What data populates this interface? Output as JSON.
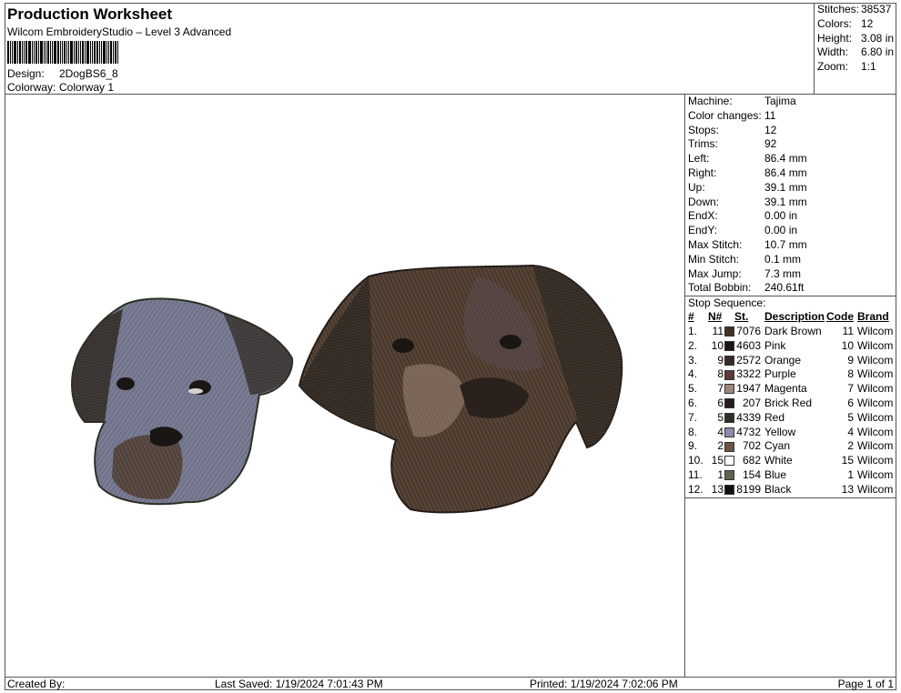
{
  "header": {
    "title": "Production Worksheet",
    "subtitle": "Wilcom EmbroideryStudio – Level 3 Advanced",
    "design_label": "Design:",
    "design_value": "2DogBS6_8",
    "colorway_label": "Colorway:",
    "colorway_value": "Colorway 1"
  },
  "stats": {
    "stitches_label": "Stitches:",
    "stitches_value": "38537",
    "colors_label": "Colors:",
    "colors_value": "12",
    "height_label": "Height:",
    "height_value": "3.08 in",
    "width_label": "Width:",
    "width_value": "6.80 in",
    "zoom_label": "Zoom:",
    "zoom_value": "1:1"
  },
  "machine": [
    {
      "label": "Machine:",
      "value": "Tajima"
    },
    {
      "label": "Color changes:",
      "value": "11"
    },
    {
      "label": "Stops:",
      "value": "12"
    },
    {
      "label": "Trims:",
      "value": "92"
    },
    {
      "label": "Left:",
      "value": "86.4 mm"
    },
    {
      "label": "Right:",
      "value": "86.4 mm"
    },
    {
      "label": "Up:",
      "value": "39.1 mm"
    },
    {
      "label": "Down:",
      "value": "39.1 mm"
    },
    {
      "label": "EndX:",
      "value": "0.00 in"
    },
    {
      "label": "EndY:",
      "value": "0.00 in"
    },
    {
      "label": "Max Stitch:",
      "value": "10.7 mm"
    },
    {
      "label": "Min Stitch:",
      "value": "0.1 mm"
    },
    {
      "label": "Max Jump:",
      "value": "7.3 mm"
    },
    {
      "label": "Total Bobbin:",
      "value": "240.61ft"
    }
  ],
  "stop_sequence": {
    "heading": "Stop Sequence:",
    "columns": [
      "#",
      "N#",
      "St.",
      "Description",
      "Code",
      "Brand"
    ],
    "rows": [
      {
        "idx": "1.",
        "n": "11",
        "color": "#3d3128",
        "st": "7076",
        "desc": "Dark Brown",
        "code": "11",
        "brand": "Wilcom"
      },
      {
        "idx": "2.",
        "n": "10",
        "color": "#1d1614",
        "st": "4603",
        "desc": "Pink",
        "code": "10",
        "brand": "Wilcom"
      },
      {
        "idx": "3.",
        "n": "9",
        "color": "#3a2a26",
        "st": "2572",
        "desc": "Orange",
        "code": "9",
        "brand": "Wilcom"
      },
      {
        "idx": "4.",
        "n": "8",
        "color": "#5b3a3a",
        "st": "3322",
        "desc": "Purple",
        "code": "8",
        "brand": "Wilcom"
      },
      {
        "idx": "5.",
        "n": "7",
        "color": "#a0857a",
        "st": "1947",
        "desc": "Magenta",
        "code": "7",
        "brand": "Wilcom"
      },
      {
        "idx": "6.",
        "n": "6",
        "color": "#241b1a",
        "st": "207",
        "desc": "Brick Red",
        "code": "6",
        "brand": "Wilcom"
      },
      {
        "idx": "7.",
        "n": "5",
        "color": "#2c3124",
        "st": "4339",
        "desc": "Red",
        "code": "5",
        "brand": "Wilcom"
      },
      {
        "idx": "8.",
        "n": "4",
        "color": "#8a8ca8",
        "st": "4732",
        "desc": "Yellow",
        "code": "4",
        "brand": "Wilcom"
      },
      {
        "idx": "9.",
        "n": "2",
        "color": "#6b5444",
        "st": "702",
        "desc": "Cyan",
        "code": "2",
        "brand": "Wilcom"
      },
      {
        "idx": "10.",
        "n": "15",
        "color": "#ffffff",
        "st": "682",
        "desc": "White",
        "code": "15",
        "brand": "Wilcom"
      },
      {
        "idx": "11.",
        "n": "1",
        "color": "#5f6450",
        "st": "154",
        "desc": "Blue",
        "code": "1",
        "brand": "Wilcom"
      },
      {
        "idx": "12.",
        "n": "13",
        "color": "#111111",
        "st": "8199",
        "desc": "Black",
        "code": "13",
        "brand": "Wilcom"
      }
    ]
  },
  "footer": {
    "created": "Created By:",
    "saved": "Last Saved: 1/19/2024 7:01:43 PM",
    "printed": "Printed: 1/19/2024 7:02:06 PM",
    "page": "Page 1 of 1"
  }
}
